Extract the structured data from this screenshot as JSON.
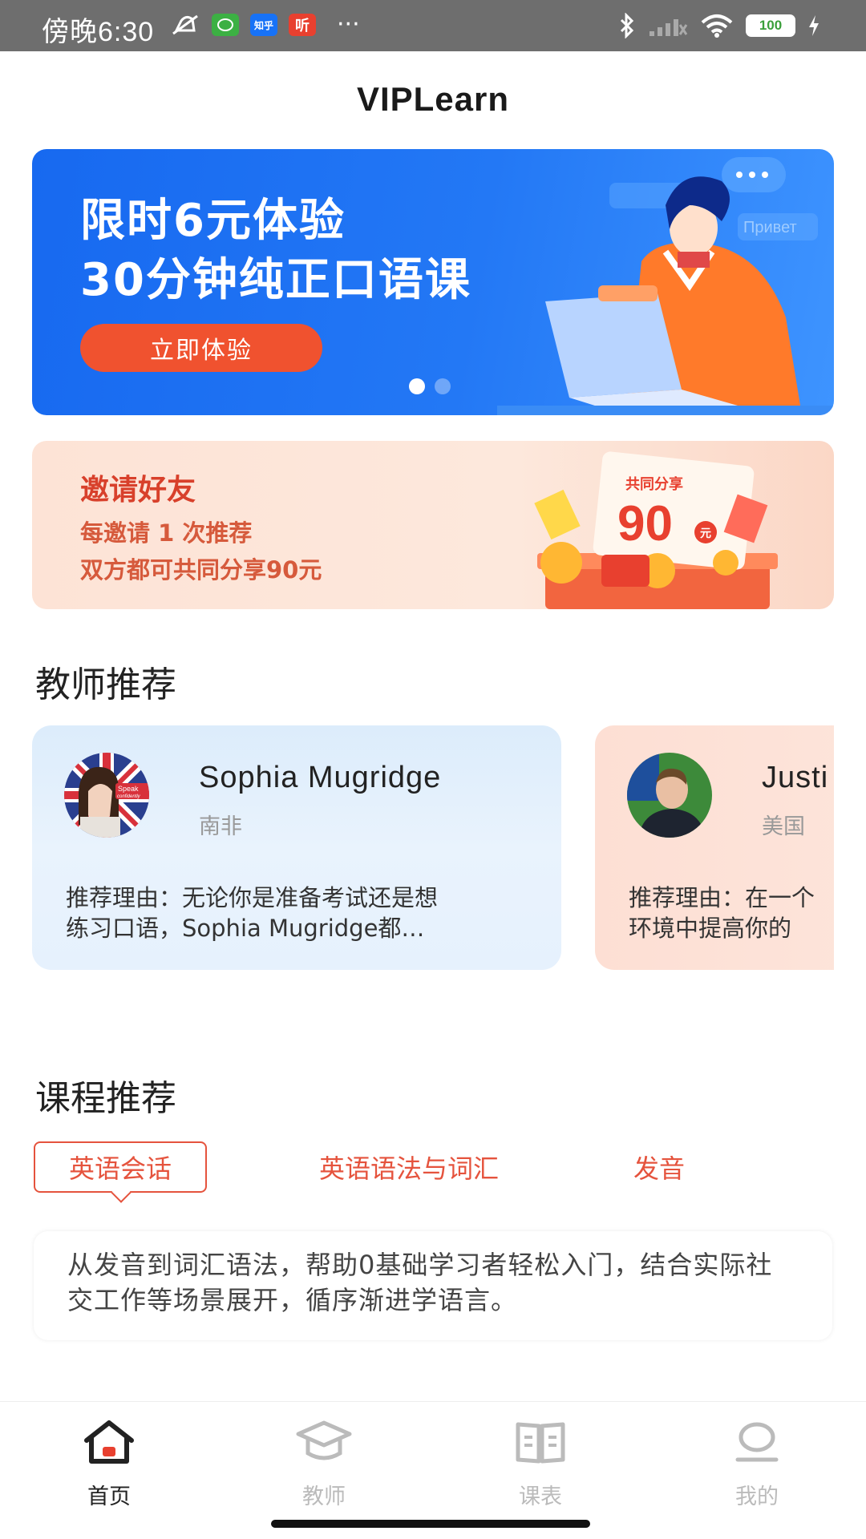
{
  "status_bar": {
    "time": "傍晚6:30",
    "apps": [
      "知乎",
      "听"
    ],
    "battery": "100"
  },
  "app": {
    "title": "VIPLearn"
  },
  "banner": {
    "line1": "限时6元体验",
    "line2": "30分钟纯正口语课",
    "button": "立即体验",
    "bubble_text": "Привет",
    "active_slide": 1,
    "slide_count": 2,
    "bg_color": "#2378f5",
    "button_color": "#f0522f"
  },
  "invite": {
    "title": "邀请好友",
    "line1": "每邀请 1 次推荐",
    "line2": "双方都可共同分享90元",
    "badge_title": "共同分享",
    "badge_amount": "90",
    "badge_unit": "元"
  },
  "teachers_section": {
    "title": "教师推荐",
    "cards": [
      {
        "name": "Sophia Mugridge",
        "country": "南非",
        "reason_line1": "推荐理由：无论你是准备考试还是想",
        "reason_line2": "练习口语，Sophia Mugridge都…",
        "avatar_caption1": "Speak",
        "avatar_caption2": "confidently"
      },
      {
        "name": "Justi",
        "country": "美国",
        "reason_line1": "推荐理由：在一个",
        "reason_line2": "环境中提高你的"
      }
    ]
  },
  "courses_section": {
    "title": "课程推荐",
    "tabs": [
      "英语会话",
      "英语语法与词汇",
      "发音"
    ],
    "active_tab": 0,
    "description": "从发音到词汇语法，帮助0基础学习者轻松入门，结合实际社交工作等场景展开，循序渐进学语言。",
    "accent_color": "#e5533d"
  },
  "bottom_nav": {
    "items": [
      {
        "label": "首页",
        "icon": "home-icon",
        "active": true
      },
      {
        "label": "教师",
        "icon": "graduation-cap-icon",
        "active": false
      },
      {
        "label": "课表",
        "icon": "book-icon",
        "active": false
      },
      {
        "label": "我的",
        "icon": "person-icon",
        "active": false
      }
    ]
  }
}
